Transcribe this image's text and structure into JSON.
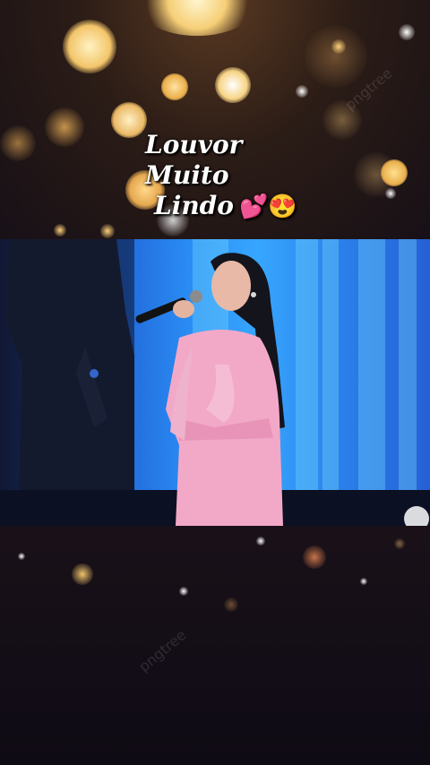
{
  "caption": {
    "line1": "Louvor Muito",
    "line2": "Lindo",
    "emoji": "💕😍"
  },
  "watermarks": [
    "pngtree",
    "pngtree"
  ],
  "colors": {
    "bokeh_gold": "#f3c56a",
    "video_blue": "#2a8ef5",
    "dress_pink": "#f2a9c7"
  }
}
